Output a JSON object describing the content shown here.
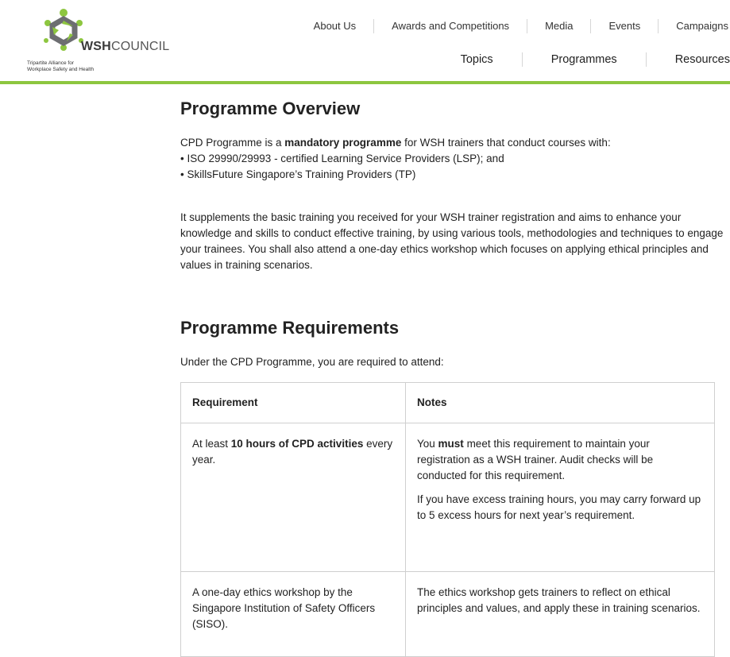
{
  "brand": {
    "logo_bold": "WSH",
    "logo_rest": "COUNCIL",
    "tagline_line1": "Tripartite Alliance for",
    "tagline_line2": "Workplace Safety and Health",
    "colors": {
      "accent_green": "#8dc63f",
      "logo_grey": "#6d6e71"
    }
  },
  "nav_top": [
    "About Us",
    "Awards and Competitions",
    "Media",
    "Events",
    "Campaigns"
  ],
  "nav_main": [
    "Topics",
    "Programmes",
    "Resources"
  ],
  "overview": {
    "heading": "Programme Overview",
    "intro_before": "CPD Programme is a ",
    "intro_bold": "mandatory programme",
    "intro_after": " for WSH trainers that conduct courses with:",
    "bullet1": "• ISO 29990/29993 - certified Learning Service Providers (LSP); and",
    "bullet2": "• SkillsFuture Singapore’s  Training Providers  (TP)",
    "paragraph": "It supplements the basic training you received for your WSH trainer registration and aims to enhance your knowledge and skills to conduct effective training, by using various tools, methodologies and techniques to engage your trainees. You shall also attend a one-day ethics workshop which focuses on applying ethical principles and values in training scenarios."
  },
  "requirements": {
    "heading": "Programme Requirements",
    "intro": "Under the CPD Programme, you are required to attend:",
    "table_headers": [
      "Requirement",
      "Notes"
    ],
    "row1": {
      "req_before": "At least ",
      "req_bold": "10 hours of CPD activities",
      "req_after": " every year.",
      "note1_before": "You ",
      "note1_bold": "must",
      "note1_after": " meet this requirement to maintain your registration as a WSH trainer. Audit checks will be conducted for this requirement.",
      "note2": "If you have excess training hours, you may carry forward up to 5 excess hours for next year’s requirement."
    },
    "row2": {
      "req": "A one-day ethics workshop by the Singapore Institution of Safety Officers (SISO).",
      "note": "The ethics workshop gets trainers to reflect on ethical principles and values, and apply these in training scenarios."
    }
  }
}
